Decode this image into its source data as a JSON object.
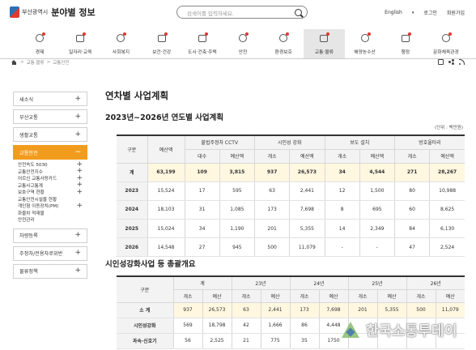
{
  "header": {
    "org": "부산광역시",
    "title": "분야별 정보",
    "search_placeholder": "검색어를 입력하세요.",
    "lang": "English",
    "login": "로그인",
    "signup": "회원가입"
  },
  "menu": [
    {
      "label": "경제",
      "icon": "economy-icon"
    },
    {
      "label": "일자리·교육",
      "icon": "jobs-icon"
    },
    {
      "label": "사회복지",
      "icon": "welfare-icon"
    },
    {
      "label": "보건·건강",
      "icon": "health-icon"
    },
    {
      "label": "도시·건축·주택",
      "icon": "city-icon"
    },
    {
      "label": "안전",
      "icon": "safety-icon"
    },
    {
      "label": "환경보호",
      "icon": "environment-icon"
    },
    {
      "label": "교통·물류",
      "icon": "traffic-icon",
      "active": true
    },
    {
      "label": "해양농수산",
      "icon": "ocean-icon"
    },
    {
      "label": "행정",
      "icon": "admin-icon"
    },
    {
      "label": "문화체육관광",
      "icon": "culture-icon"
    }
  ],
  "breadcrumb": [
    "교통·물류",
    "교통안전"
  ],
  "sidebar": {
    "items": [
      {
        "label": "새소식"
      },
      {
        "label": "부산교통"
      },
      {
        "label": "생활교통"
      },
      {
        "label": "교통안전",
        "active": true
      },
      {
        "label": "차량등록"
      },
      {
        "label": "주정차/전용차로위반"
      },
      {
        "label": "물류정책"
      }
    ],
    "sub": [
      {
        "label": "안전속도 5030",
        "plus": true
      },
      {
        "label": "교통안전지수",
        "plus": true
      },
      {
        "label": "어르신 교통사랑카드",
        "plus": true
      },
      {
        "label": "교통사고통계",
        "plus": true
      },
      {
        "label": "보호구역 현황",
        "plus": true
      },
      {
        "label": "교통안전시설물 현황",
        "plus": false
      },
      {
        "label": "개인형 이동장치(PM)",
        "plus": true
      },
      {
        "label": "화물차 적재물",
        "plus": false
      },
      {
        "label": "안전관리",
        "plus": false
      }
    ]
  },
  "content": {
    "title": "연차별 사업계획",
    "subtitle": "2023년~2026년 연도별 사업계획",
    "unit": "(단위 : 백만원)",
    "section2": "시인성강화사업 등 총괄개요"
  },
  "table1": {
    "h_div": "구분",
    "h_budget": "예산액",
    "groups": [
      "불법주정차 CCTV",
      "시인성 강화",
      "보도 설치",
      "방호울타리"
    ],
    "sub": [
      "대수",
      "예산액",
      "개소",
      "예산액",
      "개소",
      "예산액",
      "개소",
      "예산액"
    ],
    "rows": [
      {
        "label": "계",
        "values": [
          "63,199",
          "109",
          "3,815",
          "937",
          "26,573",
          "34",
          "4,544",
          "271",
          "28,267"
        ]
      },
      {
        "label": "2023",
        "values": [
          "15,524",
          "17",
          "595",
          "63",
          "2,441",
          "12",
          "1,500",
          "80",
          "10,988"
        ]
      },
      {
        "label": "2024",
        "values": [
          "18,103",
          "31",
          "1,085",
          "173",
          "7,698",
          "8",
          "695",
          "60",
          "8,625"
        ]
      },
      {
        "label": "2025",
        "values": [
          "15,024",
          "34",
          "1,190",
          "201",
          "5,355",
          "14",
          "2,349",
          "84",
          "6,130"
        ]
      },
      {
        "label": "2026",
        "values": [
          "14,548",
          "27",
          "945",
          "500",
          "11,079",
          "-",
          "-",
          "47",
          "2,524"
        ]
      }
    ]
  },
  "table2": {
    "h_div": "구분",
    "groups": [
      "계",
      "23년",
      "24년",
      "25년",
      "26년"
    ],
    "sub": [
      "개소",
      "예산",
      "개소",
      "예산",
      "개소",
      "예산",
      "개소",
      "예산",
      "개소",
      "예산"
    ],
    "rows": [
      {
        "label": "소 계",
        "values": [
          "937",
          "26,573",
          "63",
          "2,441",
          "173",
          "7,698",
          "201",
          "5,355",
          "500",
          "11,079"
        ]
      },
      {
        "label": "시인성강화",
        "values": [
          "569",
          "18,798",
          "42",
          "1,666",
          "86",
          "4,448",
          "",
          "",
          "",
          ""
        ]
      },
      {
        "label": "과속·신호기",
        "values": [
          "56",
          "2,525",
          "21",
          "775",
          "35",
          "1750",
          "",
          "",
          "",
          ""
        ]
      }
    ]
  },
  "watermark": "한국소통투데이"
}
